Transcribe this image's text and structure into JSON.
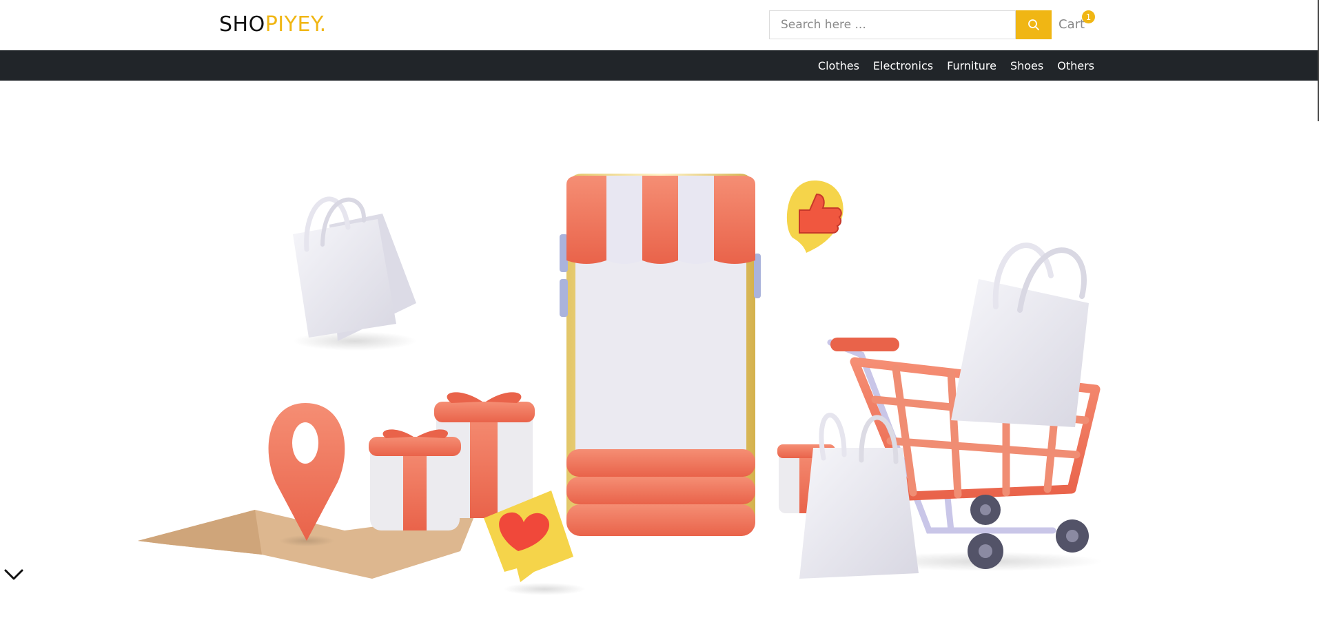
{
  "brand": {
    "part1": "SHO",
    "part2": "PIYEY."
  },
  "search": {
    "placeholder": "Search here ...",
    "value": ""
  },
  "cart": {
    "label": "Cart",
    "count": "1"
  },
  "nav": {
    "items": [
      "Clothes",
      "Electronics",
      "Furniture",
      "Shoes",
      "Others"
    ]
  },
  "colors": {
    "accent": "#f0b614",
    "navbar": "#212529",
    "coral": "#ef7a5f",
    "white_item": "#ecebf2"
  },
  "icons": {
    "search": "search-icon",
    "scroll": "chevron-down-icon"
  }
}
